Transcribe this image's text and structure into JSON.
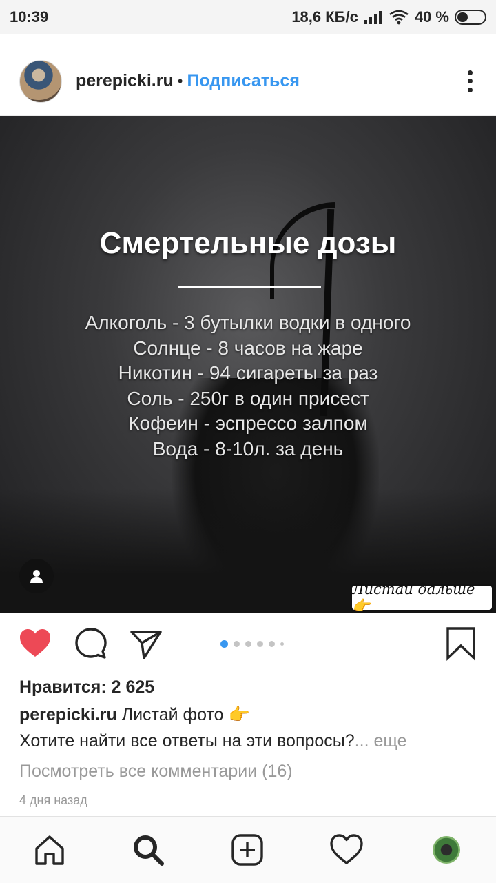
{
  "status_bar": {
    "time": "10:39",
    "network_speed": "18,6 КБ/с",
    "battery_text": "40 %",
    "battery_level": 0.4,
    "icons": [
      "signal-icon",
      "wifi-icon",
      "battery-icon"
    ]
  },
  "post": {
    "username": "perepicki.ru",
    "separator": "•",
    "follow_label": "Подписаться",
    "image": {
      "title": "Смертельные дозы",
      "lines": [
        "Алкоголь - 3 бутылки водки в одного",
        "Солнце - 8 часов на жаре",
        "Никотин - 94 сигареты за раз",
        "Соль - 250г в один присест",
        "Кофеин - эспрессо залпом",
        "Вода - 8-10л. за день"
      ],
      "swipe_badge": "Листай дальше👉"
    },
    "carousel": {
      "total_dots": 6,
      "active_index": 0
    },
    "likes": "Нравится: 2 625",
    "caption_user": "perepicki.ru",
    "caption_text": "Листай фото 👉",
    "caption_line2": "Хотите найти все ответы на эти вопросы?",
    "more_label": "... еще",
    "view_comments": "Посмотреть все комментарии (16)",
    "time_ago": "4 дня назад"
  },
  "colors": {
    "accent": "#3897f0",
    "like_red": "#ed4956",
    "text": "#262626",
    "muted": "#999999"
  },
  "bottom_nav": [
    "home-icon",
    "search-icon",
    "new-post-icon",
    "activity-icon",
    "profile-icon"
  ]
}
